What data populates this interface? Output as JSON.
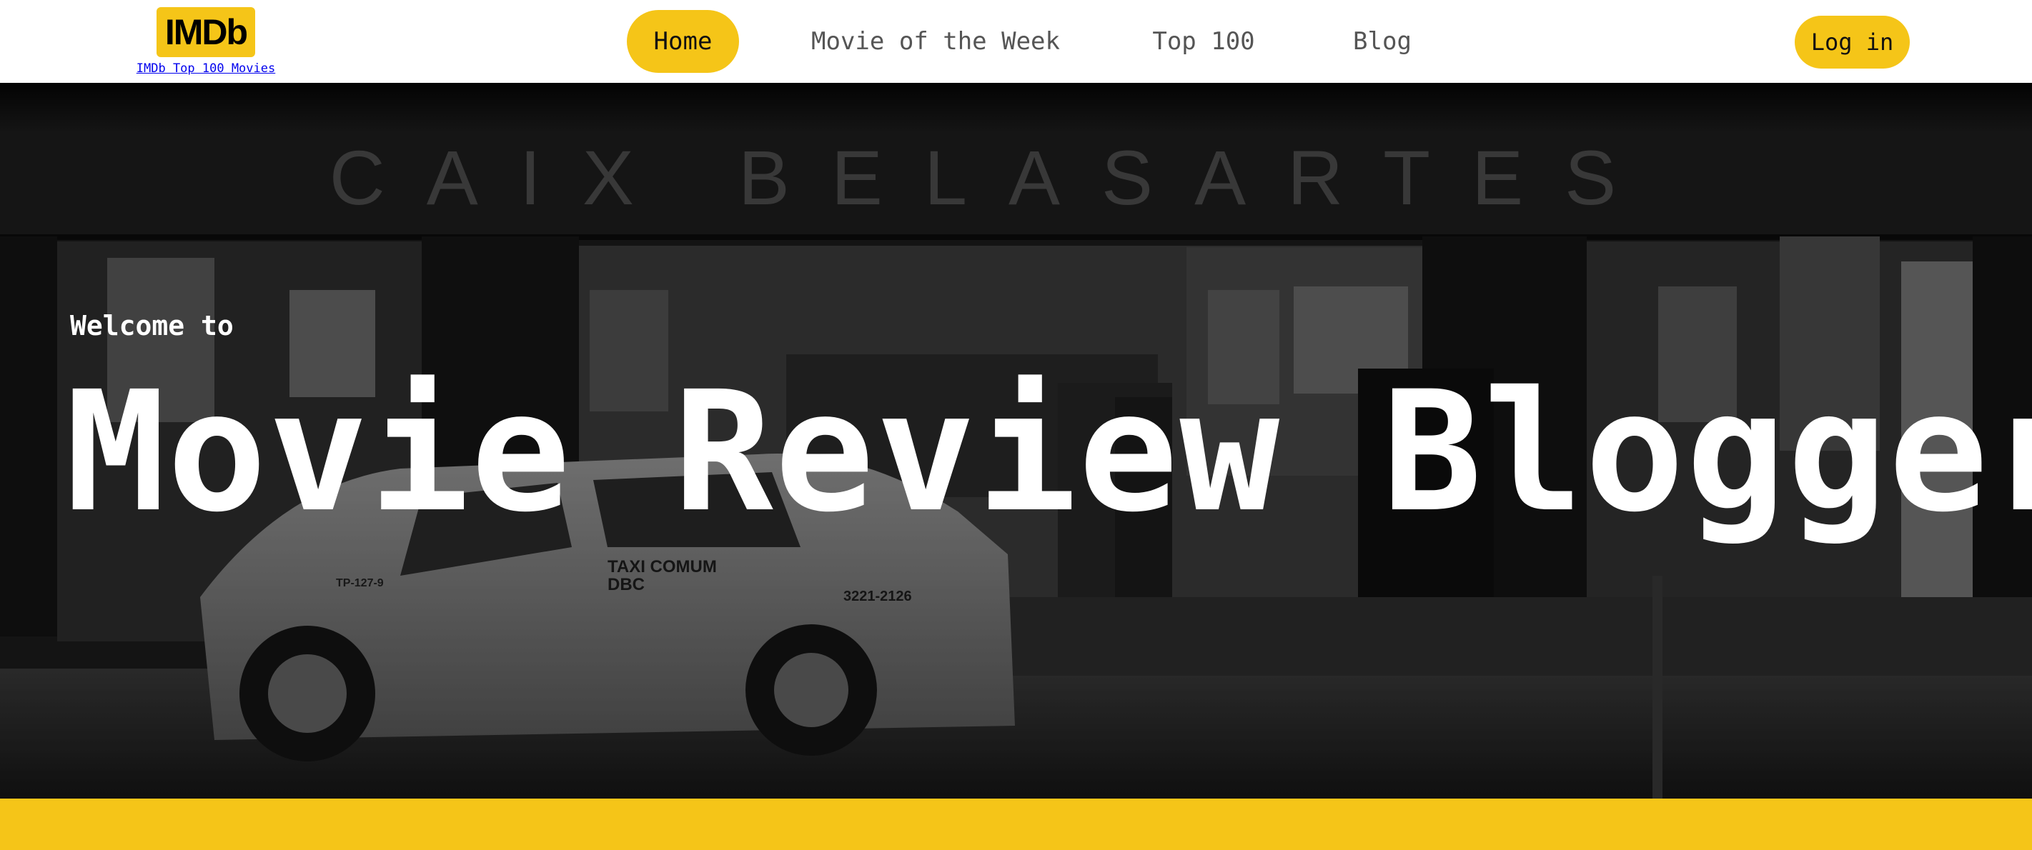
{
  "header": {
    "logo_text": "IMDb",
    "logo_link": "IMDb Top 100 Movies",
    "nav": [
      {
        "label": "Home",
        "active": true
      },
      {
        "label": "Movie of the Week",
        "active": false
      },
      {
        "label": "Top 100",
        "active": false
      },
      {
        "label": "Blog",
        "active": false
      }
    ],
    "login_label": "Log in"
  },
  "hero": {
    "background_text": "CAIX BELASARTES",
    "taxi_line1": "TAXI COMUM",
    "taxi_line2": "DBC",
    "taxi_phone": "3221-2126",
    "taxi_plate": "TP-127-9",
    "welcome": "Welcome to",
    "title": "Movie Review Blogger"
  },
  "colors": {
    "accent": "#f5c518",
    "header_bg": "#ffffff",
    "nav_text": "#555555",
    "hero_text": "#ffffff"
  }
}
